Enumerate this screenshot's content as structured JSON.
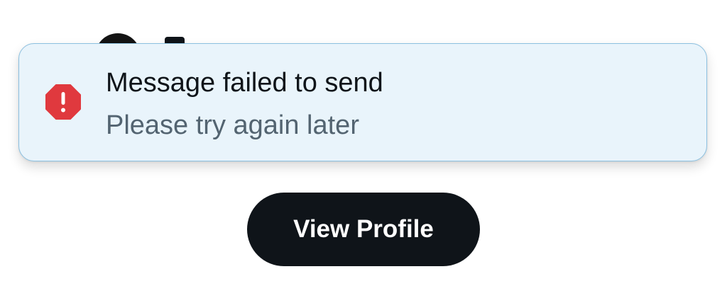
{
  "toast": {
    "title": "Message failed to send",
    "subtitle": "Please try again later",
    "icon": "error-octagon-icon"
  },
  "profile": {
    "button_label": "View Profile"
  },
  "colors": {
    "toast_background": "#e9f4fb",
    "toast_border": "#8cc0e0",
    "error_icon": "#e0393e",
    "title_text": "#0f1419",
    "subtitle_text": "#536471",
    "button_background": "#0f1419",
    "button_text": "#ffffff"
  }
}
